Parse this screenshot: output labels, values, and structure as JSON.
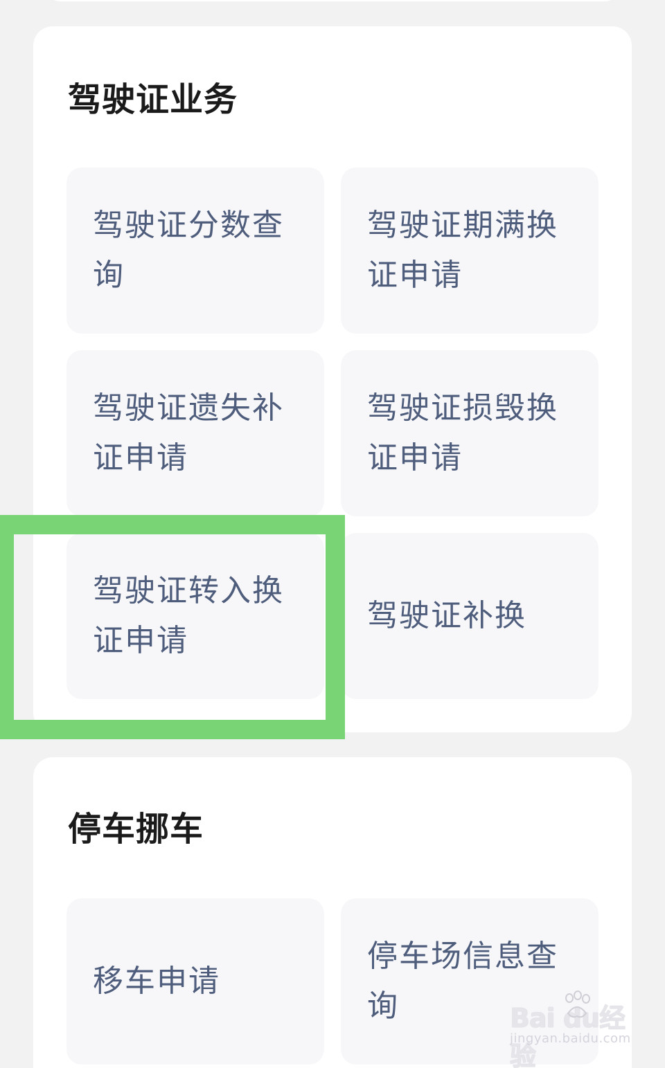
{
  "sections": [
    {
      "title": "驾驶证业务",
      "tiles": [
        {
          "label": "驾驶证分数查询"
        },
        {
          "label": "驾驶证期满换证申请"
        },
        {
          "label": "驾驶证遗失补证申请"
        },
        {
          "label": "驾驶证损毁换证申请"
        },
        {
          "label": "驾驶证转入换证申请"
        },
        {
          "label": "驾驶证补换"
        }
      ]
    },
    {
      "title": "停车挪车",
      "tiles": [
        {
          "label": "移车申请"
        },
        {
          "label": "停车场信息查询"
        }
      ]
    }
  ],
  "highlight": {
    "target": "驾驶证转入换证申请",
    "color": "#78d475"
  },
  "watermark": {
    "logo": "Bai du经验",
    "url": "jingyan.baidu.com"
  },
  "colors": {
    "tile_text": "#4f5d7c",
    "tile_bg": "#f7f7fa",
    "title_text": "#1a1a1a"
  }
}
